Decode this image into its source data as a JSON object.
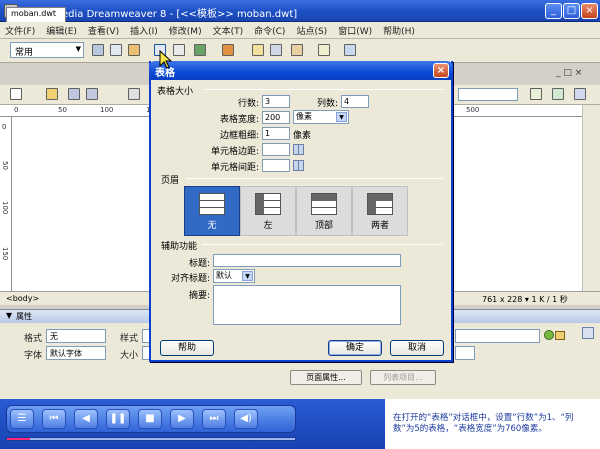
{
  "window": {
    "title": "Macromedia Dreamweaver 8 - [<<模板>> moban.dwt]",
    "min": "_",
    "max": "□",
    "close": "×"
  },
  "menu": [
    "文件(F)",
    "编辑(E)",
    "查看(V)",
    "插入(I)",
    "修改(M)",
    "文本(T)",
    "命令(C)",
    "站点(S)",
    "窗口(W)",
    "帮助(H)"
  ],
  "toolbar": {
    "category": "常用"
  },
  "document": {
    "tab": "moban.dwt",
    "controls": "_ □ ×",
    "status_tag": "<body>",
    "status_info": "761 x 228 ▾ 1 K / 1 秒"
  },
  "ruler": {
    "top": [
      "0",
      "50",
      "100",
      "150",
      "200",
      "250",
      "300",
      "350",
      "400",
      "450",
      "500"
    ]
  },
  "properties": {
    "header": "属性",
    "format_label": "格式",
    "format_value": "无",
    "style_label": "样式",
    "font_label": "字体",
    "font_value": "默认字体",
    "size_label": "大小",
    "page_props_button": "页面属性...",
    "list_item_button": "列表项目..."
  },
  "dialog": {
    "title": "表格",
    "close": "×",
    "table_size_section": "表格大小",
    "rows_label": "行数:",
    "rows_value": "3",
    "cols_label": "列数:",
    "cols_value": "4",
    "width_label": "表格宽度:",
    "width_value": "200",
    "width_unit": "像素",
    "border_label": "边框粗细:",
    "border_value": "1",
    "border_unit": "像素",
    "padding_label": "单元格边距:",
    "padding_value": "",
    "spacing_label": "单元格间距:",
    "spacing_value": "",
    "header_section": "页眉",
    "header_options": [
      "无",
      "左",
      "顶部",
      "两者"
    ],
    "header_selected": "无",
    "accessibility_section": "辅助功能",
    "caption_label": "标题:",
    "caption_value": "",
    "align_caption_label": "对齐标题:",
    "align_caption_value": "默认",
    "summary_label": "摘要:",
    "summary_value": "",
    "help_button": "帮助",
    "ok_button": "确定",
    "cancel_button": "取消"
  },
  "tutorial": {
    "caption": "在打开的“表格”对话框中，设置“行数”为1、“列数”为5的表格，“表格宽度”为760像素。",
    "progress": 0.08
  }
}
